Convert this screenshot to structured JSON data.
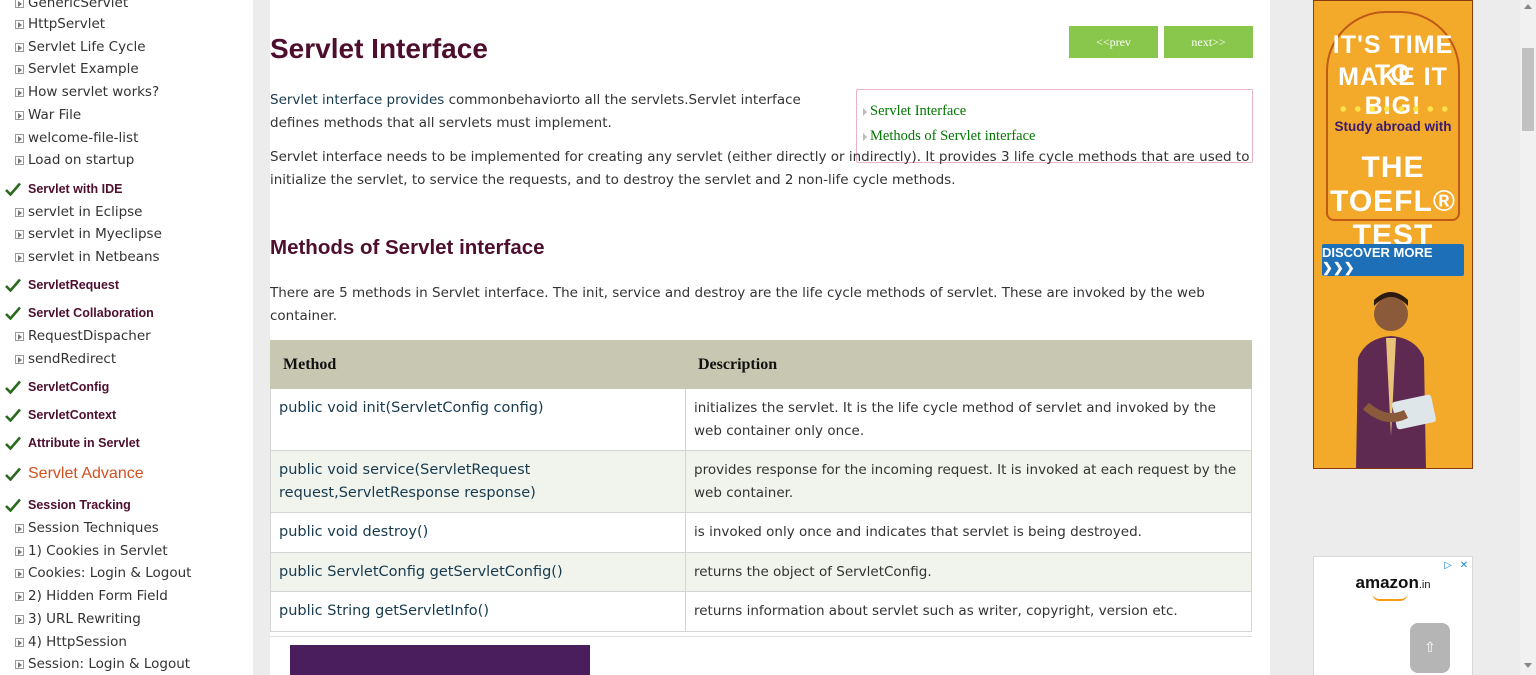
{
  "sidebar": {
    "items": [
      {
        "type": "sub",
        "label": "GenericServlet"
      },
      {
        "type": "sub",
        "label": "HttpServlet"
      },
      {
        "type": "sub",
        "label": "Servlet Life Cycle"
      },
      {
        "type": "sub",
        "label": "Servlet Example"
      },
      {
        "type": "sub",
        "label": "How servlet works?"
      },
      {
        "type": "sub",
        "label": "War File"
      },
      {
        "type": "sub",
        "label": "welcome-file-list"
      },
      {
        "type": "sub",
        "label": "Load on startup"
      },
      {
        "type": "head",
        "label": "Servlet with IDE"
      },
      {
        "type": "sub",
        "label": "servlet in Eclipse"
      },
      {
        "type": "sub",
        "label": "servlet in Myeclipse"
      },
      {
        "type": "sub",
        "label": "servlet in Netbeans"
      },
      {
        "type": "head",
        "label": "ServletRequest"
      },
      {
        "type": "head",
        "label": "Servlet Collaboration"
      },
      {
        "type": "sub",
        "label": "RequestDispacher"
      },
      {
        "type": "sub",
        "label": "sendRedirect"
      },
      {
        "type": "head",
        "label": "ServletConfig"
      },
      {
        "type": "head",
        "label": "ServletContext"
      },
      {
        "type": "head",
        "label": "Attribute in Servlet"
      },
      {
        "type": "advance",
        "label": "Servlet Advance"
      },
      {
        "type": "head",
        "label": "Session Tracking"
      },
      {
        "type": "sub",
        "label": "Session Techniques"
      },
      {
        "type": "sub",
        "label": "1) Cookies in Servlet"
      },
      {
        "type": "sub",
        "label": "Cookies: Login & Logout"
      },
      {
        "type": "sub",
        "label": "2) Hidden Form Field"
      },
      {
        "type": "sub",
        "label": "3) URL Rewriting"
      },
      {
        "type": "sub",
        "label": "4) HttpSession"
      },
      {
        "type": "sub",
        "label": "Session: Login & Logout"
      }
    ]
  },
  "main": {
    "title": "Servlet Interface",
    "prev_label": "<<prev",
    "next_label": "next>>",
    "intro_highlight": "Servlet interface provides",
    "intro_rest": " commonbehaviorto all the servlets.Servlet interface defines methods that all servlets must implement.",
    "para2": "Servlet interface needs to be implemented for creating any servlet (either directly or indirectly). It provides 3 life cycle methods that are used to initialize the servlet, to service the requests, and to destroy the servlet and 2 non-life cycle methods.",
    "toc": [
      "Servlet Interface",
      "Methods of Servlet interface"
    ],
    "methods_heading": "Methods of Servlet interface",
    "para3": "There are 5 methods in Servlet interface. The init, service and destroy are the life cycle methods of servlet. These are invoked by the web container.",
    "table": {
      "headers": [
        "Method",
        "Description"
      ],
      "rows": [
        [
          "public void init(ServletConfig config)",
          "initializes the servlet. It is the life cycle method of servlet and invoked by the web container only once."
        ],
        [
          "public void service(ServletRequest request,ServletResponse response)",
          "provides response for the incoming request. It is invoked at each request by the web container."
        ],
        [
          "public void destroy()",
          "is invoked only once and indicates that servlet is being destroyed."
        ],
        [
          "public ServletConfig getServletConfig()",
          "returns the object of ServletConfig."
        ],
        [
          "public String getServletInfo()",
          "returns information about servlet such as writer, copyright, version etc."
        ]
      ]
    }
  },
  "ads": {
    "toefl": {
      "line1": "IT'S TIME TO",
      "line2": "MAKE IT BIG!",
      "line3": "Study abroad with",
      "line4": "THE TOEFL® TEST",
      "cta": "DISCOVER MORE ❯❯❯",
      "bg_color": "#f3a92a",
      "cta_color": "#1d70b7"
    },
    "amazon": {
      "logo": "amazon",
      "suffix": ".in",
      "icon_info": "▷",
      "icon_close": "✕"
    }
  },
  "scroll_top_icon": "⇧",
  "colors": {
    "heading": "#4e0f2e",
    "nav_button": "#89c64c",
    "toc_link": "#007700",
    "table_header": "#c8c8b2",
    "advance_heading": "#d2501f"
  }
}
